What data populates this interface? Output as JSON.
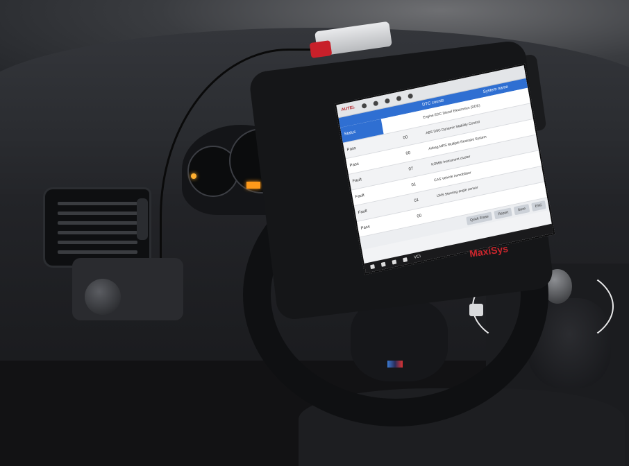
{
  "photo": {
    "screen": {
      "brand": "AUTEL",
      "header": {
        "col_dtc": "DTC counts",
        "col_system": "System name"
      },
      "rows": [
        {
          "status": "Status",
          "count": "",
          "system": "Engine EDC Diesel Electronics (DDE)"
        },
        {
          "status": "Pass",
          "count": "00",
          "system": "ABS DSC Dynamic Stability Control"
        },
        {
          "status": "Pass",
          "count": "00",
          "system": "Airbag MRS Multiple Restraint System"
        },
        {
          "status": "Fault",
          "count": "07",
          "system": "KOMBI Instrument cluster"
        },
        {
          "status": "Fault",
          "count": "01",
          "system": "CAS Vehicle immobiliser"
        },
        {
          "status": "Fault",
          "count": "01",
          "system": "LWS Steering angle sensor"
        },
        {
          "status": "Pass",
          "count": "00",
          "system": ""
        }
      ],
      "buttons": [
        "Quick Erase",
        "Report",
        "Save",
        "ESC"
      ],
      "vci_label": "VCI"
    },
    "tablet_label": "MaxiSys",
    "badge_colors": [
      "#3b7ad1",
      "#2a2c5a",
      "#dd3333"
    ]
  }
}
